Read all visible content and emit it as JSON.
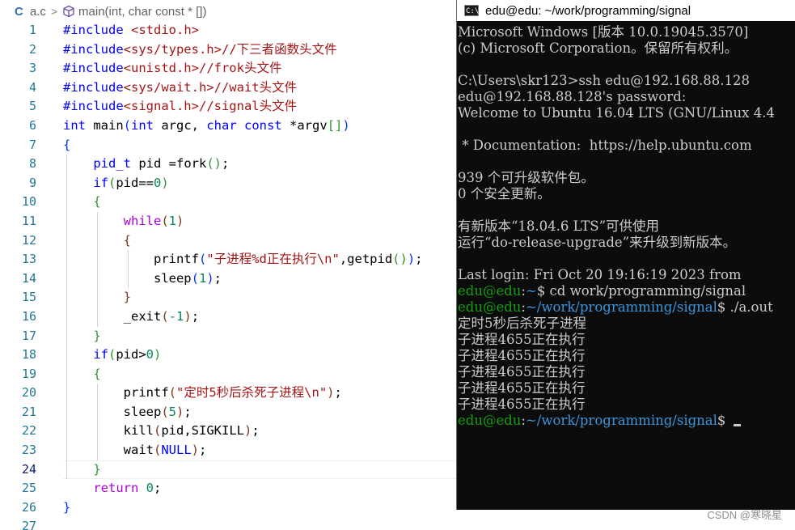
{
  "editor": {
    "breadcrumb": {
      "lang_icon": "C",
      "file": "a.c",
      "separator": ">",
      "symbol": "main(int, char const * [])"
    },
    "lines": [
      {
        "n": "1",
        "tokens": [
          [
            "kw",
            "#include"
          ],
          [
            "txt",
            " "
          ],
          [
            "str",
            "<stdio.h>"
          ]
        ]
      },
      {
        "n": "2",
        "tokens": [
          [
            "kw",
            "#include"
          ],
          [
            "str",
            "<sys/types.h>"
          ],
          [
            "str",
            "//下三者函数头文件"
          ]
        ]
      },
      {
        "n": "3",
        "tokens": [
          [
            "kw",
            "#include"
          ],
          [
            "str",
            "<unistd.h>"
          ],
          [
            "str",
            "//frok头文件"
          ]
        ]
      },
      {
        "n": "4",
        "tokens": [
          [
            "kw",
            "#include"
          ],
          [
            "str",
            "<sys/wait.h>"
          ],
          [
            "str",
            "//wait头文件"
          ]
        ]
      },
      {
        "n": "5",
        "tokens": [
          [
            "kw",
            "#include"
          ],
          [
            "str",
            "<signal.h>"
          ],
          [
            "str",
            "//signal头文件"
          ]
        ]
      },
      {
        "n": "6",
        "tokens": [
          [
            "kw",
            "int"
          ],
          [
            "txt",
            " main"
          ],
          [
            "b1",
            "("
          ],
          [
            "kw",
            "int"
          ],
          [
            "txt",
            " argc, "
          ],
          [
            "kw",
            "char"
          ],
          [
            "txt",
            " "
          ],
          [
            "kw",
            "const"
          ],
          [
            "txt",
            " *argv"
          ],
          [
            "b2",
            "[]"
          ],
          [
            "b1",
            ")"
          ]
        ]
      },
      {
        "n": "7",
        "tokens": [
          [
            "b1",
            "{"
          ]
        ]
      },
      {
        "n": "8",
        "tokens": [
          [
            "txt",
            "    "
          ],
          [
            "kw",
            "pid_t"
          ],
          [
            "txt",
            " pid =fork"
          ],
          [
            "b2",
            "()"
          ],
          [
            "txt",
            ";"
          ]
        ]
      },
      {
        "n": "9",
        "tokens": [
          [
            "txt",
            "    "
          ],
          [
            "kw",
            "if"
          ],
          [
            "b2",
            "("
          ],
          [
            "txt",
            "pid=="
          ],
          [
            "num",
            "0"
          ],
          [
            "b2",
            ")"
          ]
        ]
      },
      {
        "n": "10",
        "tokens": [
          [
            "txt",
            "    "
          ],
          [
            "b2",
            "{"
          ]
        ]
      },
      {
        "n": "11",
        "tokens": [
          [
            "txt",
            "        "
          ],
          [
            "ctl",
            "while"
          ],
          [
            "b3",
            "("
          ],
          [
            "num",
            "1"
          ],
          [
            "b3",
            ")"
          ]
        ]
      },
      {
        "n": "12",
        "tokens": [
          [
            "txt",
            "        "
          ],
          [
            "b3",
            "{"
          ]
        ]
      },
      {
        "n": "13",
        "tokens": [
          [
            "txt",
            "            printf"
          ],
          [
            "b1",
            "("
          ],
          [
            "str",
            "\"子进程%d正在执行\\n\""
          ],
          [
            "txt",
            ",getpid"
          ],
          [
            "b2",
            "()"
          ],
          [
            "b1",
            ")"
          ],
          [
            "txt",
            ";"
          ]
        ]
      },
      {
        "n": "14",
        "tokens": [
          [
            "txt",
            "            sleep"
          ],
          [
            "b1",
            "("
          ],
          [
            "num",
            "1"
          ],
          [
            "b1",
            ")"
          ],
          [
            "txt",
            ";"
          ]
        ]
      },
      {
        "n": "15",
        "tokens": [
          [
            "txt",
            "        "
          ],
          [
            "b3",
            "}"
          ]
        ]
      },
      {
        "n": "16",
        "tokens": [
          [
            "txt",
            "        _exit"
          ],
          [
            "b3",
            "("
          ],
          [
            "num",
            "-1"
          ],
          [
            "b3",
            ")"
          ],
          [
            "txt",
            ";"
          ]
        ]
      },
      {
        "n": "17",
        "tokens": [
          [
            "txt",
            "    "
          ],
          [
            "b2",
            "}"
          ]
        ]
      },
      {
        "n": "18",
        "tokens": [
          [
            "txt",
            "    "
          ],
          [
            "kw",
            "if"
          ],
          [
            "b2",
            "("
          ],
          [
            "txt",
            "pid>"
          ],
          [
            "num",
            "0"
          ],
          [
            "b2",
            ")"
          ]
        ]
      },
      {
        "n": "19",
        "tokens": [
          [
            "txt",
            "    "
          ],
          [
            "b2",
            "{"
          ]
        ]
      },
      {
        "n": "20",
        "tokens": [
          [
            "txt",
            "        printf"
          ],
          [
            "b3",
            "("
          ],
          [
            "str",
            "\"定时5秒后杀死子进程\\n\""
          ],
          [
            "b3",
            ")"
          ],
          [
            "txt",
            ";"
          ]
        ]
      },
      {
        "n": "21",
        "tokens": [
          [
            "txt",
            "        sleep"
          ],
          [
            "b3",
            "("
          ],
          [
            "num",
            "5"
          ],
          [
            "b3",
            ")"
          ],
          [
            "txt",
            ";"
          ]
        ]
      },
      {
        "n": "22",
        "tokens": [
          [
            "txt",
            "        kill"
          ],
          [
            "b3",
            "("
          ],
          [
            "txt",
            "pid,SIGKILL"
          ],
          [
            "b3",
            ")"
          ],
          [
            "txt",
            ";"
          ]
        ]
      },
      {
        "n": "23",
        "tokens": [
          [
            "txt",
            "        wait"
          ],
          [
            "b3",
            "("
          ],
          [
            "kw",
            "NULL"
          ],
          [
            "b3",
            ")"
          ],
          [
            "txt",
            ";"
          ]
        ]
      },
      {
        "n": "24",
        "tokens": [
          [
            "txt",
            "    "
          ],
          [
            "b2",
            "}"
          ]
        ],
        "current": true
      },
      {
        "n": "25",
        "tokens": [
          [
            "txt",
            "    "
          ],
          [
            "ctl",
            "return"
          ],
          [
            "txt",
            " "
          ],
          [
            "num",
            "0"
          ],
          [
            "txt",
            ";"
          ]
        ]
      },
      {
        "n": "26",
        "tokens": [
          [
            "b1",
            "}"
          ]
        ]
      },
      {
        "n": "27",
        "tokens": []
      }
    ]
  },
  "terminal": {
    "title": "edu@edu: ~/work/programming/signal",
    "icon_label": "C:\\",
    "lines": [
      [
        [
          "w",
          "Microsoft Windows [版本 10.0.19045.3570]"
        ]
      ],
      [
        [
          "w",
          "(c) Microsoft Corporation。保留所有权利。"
        ]
      ],
      [
        [
          "w",
          ""
        ]
      ],
      [
        [
          "w",
          "C:\\Users\\skr123>ssh edu@192.168.88.128"
        ]
      ],
      [
        [
          "w",
          "edu@192.168.88.128's password:"
        ]
      ],
      [
        [
          "w",
          "Welcome to Ubuntu 16.04 LTS (GNU/Linux 4.4"
        ]
      ],
      [
        [
          "w",
          ""
        ]
      ],
      [
        [
          "w",
          " * Documentation:  https://help.ubuntu.com"
        ]
      ],
      [
        [
          "w",
          ""
        ]
      ],
      [
        [
          "w",
          "939 个可升级软件包。"
        ]
      ],
      [
        [
          "w",
          "0 个安全更新。"
        ]
      ],
      [
        [
          "w",
          ""
        ]
      ],
      [
        [
          "w",
          "有新版本“18.04.6 LTS”可供使用"
        ]
      ],
      [
        [
          "w",
          "运行“do-release-upgrade”来升级到新版本。"
        ]
      ],
      [
        [
          "w",
          ""
        ]
      ],
      [
        [
          "w",
          "Last login: Fri Oct 20 19:16:19 2023 from"
        ]
      ],
      [
        [
          "g",
          "edu@edu"
        ],
        [
          "w",
          ":"
        ],
        [
          "b",
          "~"
        ],
        [
          "w",
          "$ cd work/programming/signal"
        ]
      ],
      [
        [
          "g",
          "edu@edu"
        ],
        [
          "w",
          ":"
        ],
        [
          "b",
          "~/work/programming/signal"
        ],
        [
          "w",
          "$ ./a.out"
        ]
      ],
      [
        [
          "w",
          "定时5秒后杀死子进程"
        ]
      ],
      [
        [
          "w",
          "子进程4655正在执行"
        ]
      ],
      [
        [
          "w",
          "子进程4655正在执行"
        ]
      ],
      [
        [
          "w",
          "子进程4655正在执行"
        ]
      ],
      [
        [
          "w",
          "子进程4655正在执行"
        ]
      ],
      [
        [
          "w",
          "子进程4655正在执行"
        ]
      ],
      [
        [
          "g",
          "edu@edu"
        ],
        [
          "w",
          ":"
        ],
        [
          "b",
          "~/work/programming/signal"
        ],
        [
          "w",
          "$ "
        ]
      ]
    ]
  },
  "watermark": "CSDN @寒晓星"
}
